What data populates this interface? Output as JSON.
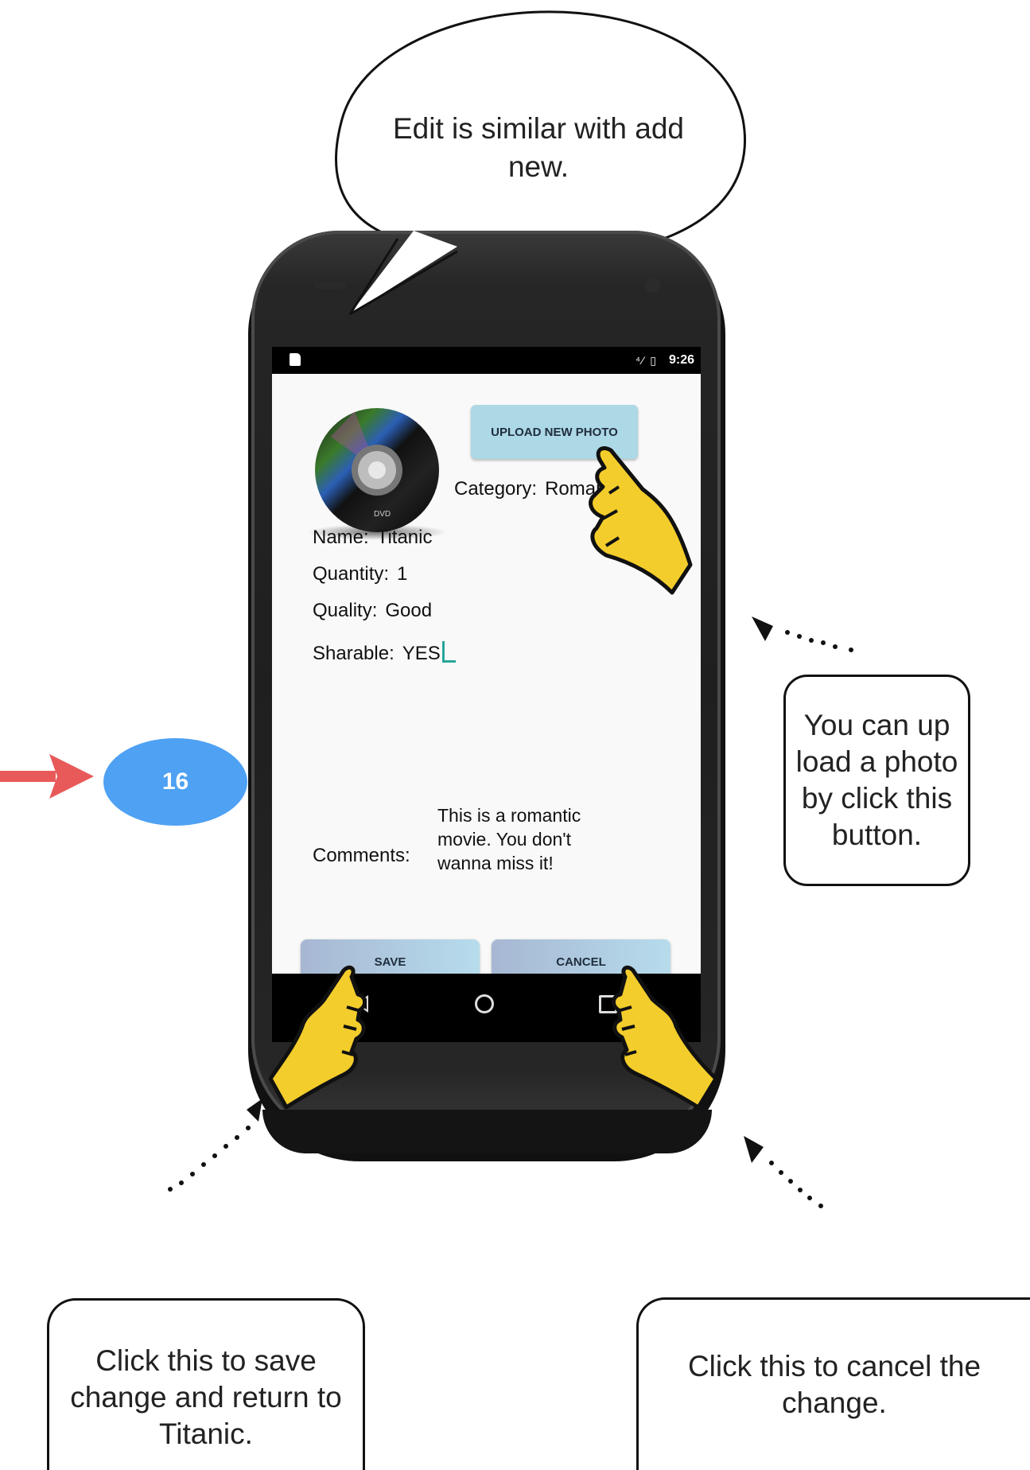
{
  "speech_bubble": {
    "text": "Edit is similar with add new."
  },
  "status_bar": {
    "time": "9:26",
    "icons": "⁴⁄ ▯"
  },
  "screen": {
    "upload_button": "UPLOAD NEW PHOTO",
    "category": {
      "label": "Category:",
      "value": "Romantic"
    },
    "fields": [
      {
        "label": "Name:",
        "value": "Titanic"
      },
      {
        "label": "Quantity:",
        "value": "1"
      },
      {
        "label": "Quality:",
        "value": "Good"
      },
      {
        "label": "Sharable:",
        "value": "YES"
      }
    ],
    "comments": {
      "label": "Comments:",
      "value": "This is a romantic movie. You don't wanna miss it!"
    },
    "save_button": "SAVE",
    "cancel_button": "CANCEL"
  },
  "callouts": {
    "upload": "You can up load a photo by click this button.",
    "save": "Click this to save change and return to Titanic.",
    "cancel": "Click this to cancel the change."
  },
  "step_badge": "16",
  "colors": {
    "step_badge": "#4ea1f3",
    "arrow_red": "#e85a5a",
    "hand_yellow": "#f3cd2b",
    "button_blue": "#add8e6",
    "cursor_teal": "#26a69a"
  },
  "icons": [
    "dvd-disc-icon",
    "back-nav-icon",
    "home-nav-icon",
    "recent-apps-nav-icon",
    "pointing-hand-icon",
    "red-arrow-icon"
  ]
}
